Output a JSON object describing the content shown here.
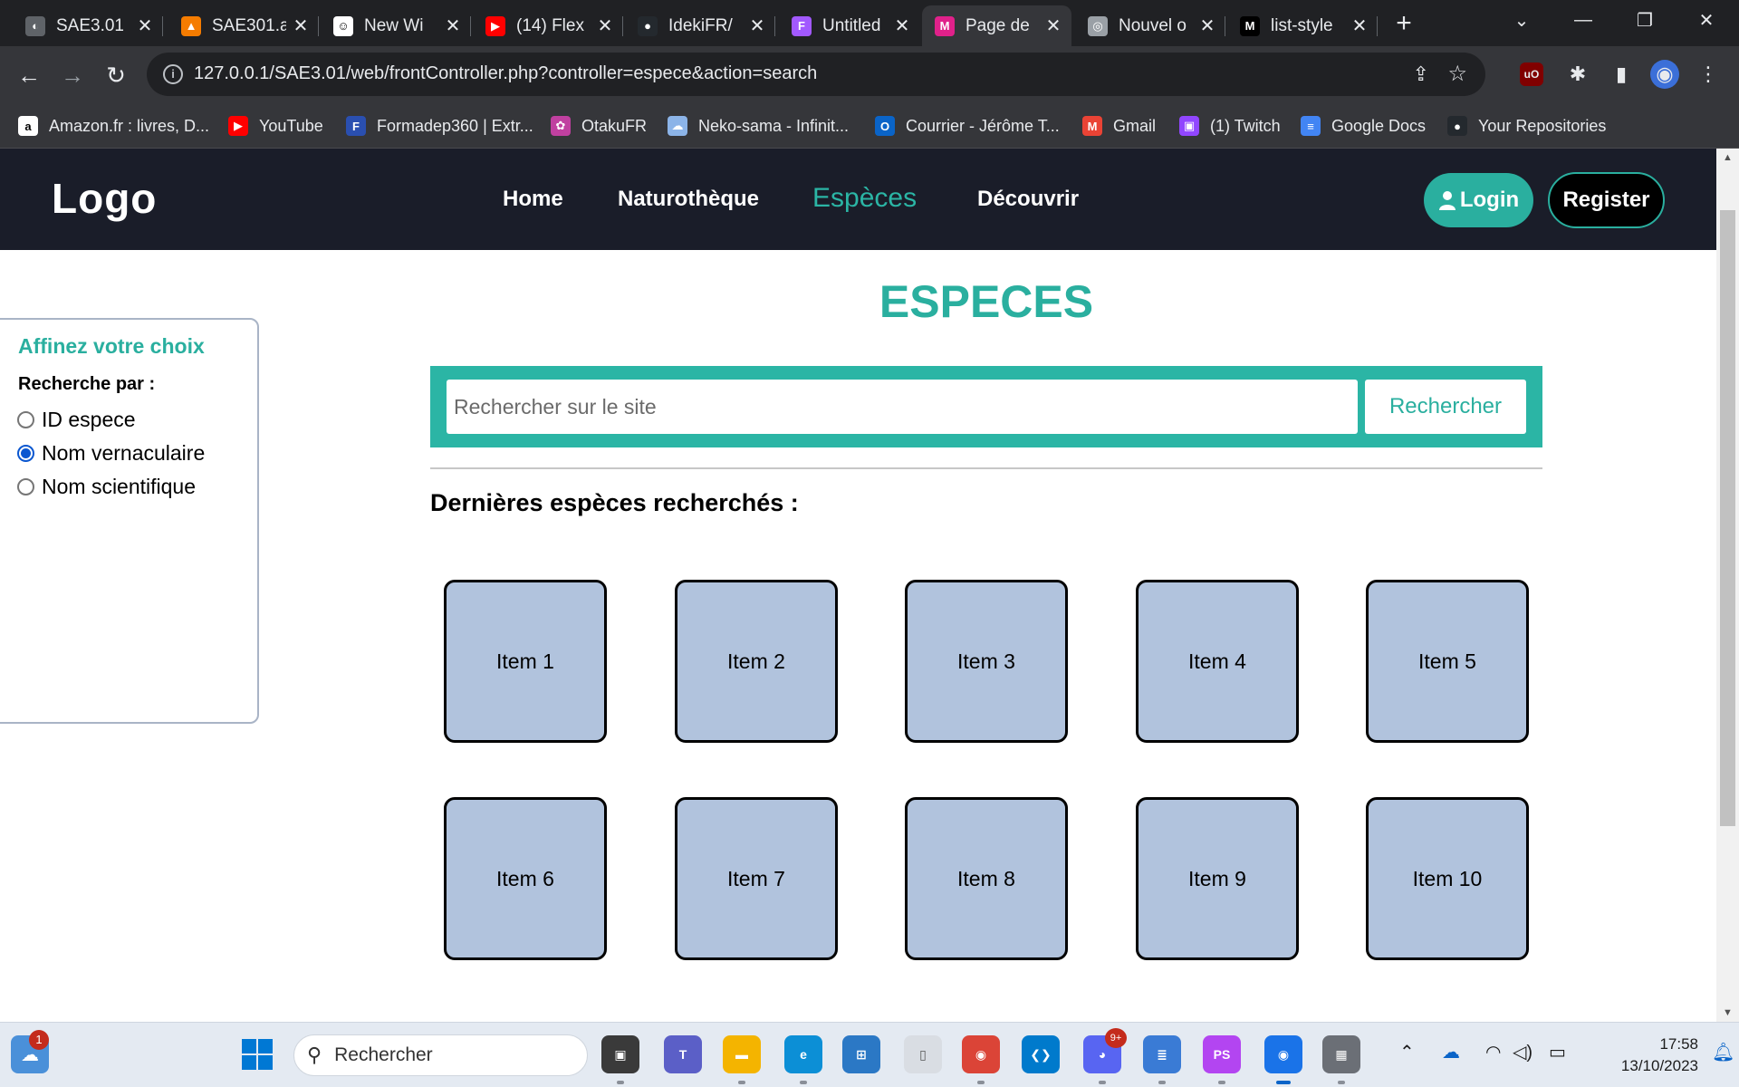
{
  "browser": {
    "tabs": [
      {
        "title": "SAE3.01",
        "color": "#5f6368",
        "glyph": "◐"
      },
      {
        "title": "SAE301.a",
        "color": "#f57c00",
        "glyph": "▲"
      },
      {
        "title": "New Wi",
        "color": "#ffffff",
        "glyph": "☺"
      },
      {
        "title": "(14) Flex",
        "color": "#ff0000",
        "glyph": "▶"
      },
      {
        "title": "IdekiFR/",
        "color": "#24292e",
        "glyph": "●"
      },
      {
        "title": "Untitled",
        "color": "#a259ff",
        "glyph": "F"
      },
      {
        "title": "Page de",
        "color": "#e0218a",
        "glyph": "M"
      },
      {
        "title": "Nouvel o",
        "color": "#9aa0a6",
        "glyph": "◎"
      },
      {
        "title": "list-style",
        "color": "#000000",
        "glyph": "M"
      }
    ],
    "active_tab_index": 6,
    "new_tab_label": "+",
    "window_controls": {
      "dropdown": "⌄",
      "minimize": "—",
      "restore": "❐",
      "close": "✕"
    },
    "nav": {
      "back": "←",
      "forward": "→",
      "reload": "↻"
    },
    "url": "127.0.0.1/SAE3.01/web/frontController.php?controller=espece&action=search",
    "info_icon_label": "i",
    "share_icon": "⇪",
    "star_icon": "☆",
    "extensions": [
      {
        "name": "ublock-icon",
        "glyph": "uO",
        "color": "#800000"
      },
      {
        "name": "puzzle-icon",
        "glyph": "✱",
        "color": "#35363a"
      },
      {
        "name": "sidepanel-icon",
        "glyph": "▮",
        "color": "#35363a"
      },
      {
        "name": "profile-avatar",
        "glyph": "◉",
        "color": "#3b6fd8"
      },
      {
        "name": "menu-icon",
        "glyph": "⋮",
        "color": "#35363a"
      }
    ],
    "bookmarks": [
      {
        "label": "Amazon.fr : livres, D...",
        "glyph": "a",
        "color": "#ffffff",
        "fg": "#000000"
      },
      {
        "label": "YouTube",
        "glyph": "▶",
        "color": "#ff0000",
        "fg": "#ffffff"
      },
      {
        "label": "Formadep360 | Extr...",
        "glyph": "F",
        "color": "#2a4fb0",
        "fg": "#ffffff"
      },
      {
        "label": "OtakuFR",
        "glyph": "✿",
        "color": "#c040a0",
        "fg": "#ffffff"
      },
      {
        "label": "Neko-sama - Infinit...",
        "glyph": "☁",
        "color": "#8cb4e8",
        "fg": "#ffffff"
      },
      {
        "label": "Courrier - Jérôme T...",
        "glyph": "O",
        "color": "#0a64c8",
        "fg": "#ffffff"
      },
      {
        "label": "Gmail",
        "glyph": "M",
        "color": "#ea4335",
        "fg": "#ffffff"
      },
      {
        "label": "(1) Twitch",
        "glyph": "▣",
        "color": "#9146ff",
        "fg": "#ffffff"
      },
      {
        "label": "Google Docs",
        "glyph": "≡",
        "color": "#4285f4",
        "fg": "#ffffff"
      },
      {
        "label": "Your Repositories",
        "glyph": "●",
        "color": "#24292e",
        "fg": "#ffffff"
      }
    ]
  },
  "site": {
    "logo": "Logo",
    "nav": [
      "Home",
      "Naturothèque",
      "Espèces",
      "Découvrir"
    ],
    "current_nav_index": 2,
    "login_label": "Login",
    "register_label": "Register",
    "accent_color": "#2aaf9f",
    "header_bg": "#1a1d29"
  },
  "filter": {
    "title": "Affinez votre choix",
    "search_by_label": "Recherche par :",
    "options": [
      {
        "label": "ID espece",
        "checked": false
      },
      {
        "label": "Nom vernaculaire",
        "checked": true
      },
      {
        "label": "Nom scientifique",
        "checked": false
      }
    ]
  },
  "main": {
    "title": "ESPECES",
    "search_placeholder": "Rechercher sur le site",
    "search_button": "Rechercher",
    "recent_title": "Dernières espèces recherchés :",
    "items": [
      "Item 1",
      "Item 2",
      "Item 3",
      "Item 4",
      "Item 5",
      "Item 6",
      "Item 7",
      "Item 8",
      "Item 9",
      "Item 10"
    ]
  },
  "taskbar": {
    "search_placeholder": "Rechercher",
    "weather_badge": "1",
    "discord_badge": "9+",
    "time": "17:58",
    "date": "13/10/2023",
    "apps": [
      {
        "name": "taskview-icon",
        "glyph": "▣",
        "color": "#3a3a3a"
      },
      {
        "name": "teams-icon",
        "glyph": "T",
        "color": "#5b5fc7"
      },
      {
        "name": "file-explorer-icon",
        "glyph": "▬",
        "color": "#f4b400"
      },
      {
        "name": "edge-icon",
        "glyph": "e",
        "color": "#0c8fd6"
      },
      {
        "name": "store-icon",
        "glyph": "⊞",
        "color": "#2b78c5"
      },
      {
        "name": "notepad-file-icon",
        "glyph": "▯",
        "color": "#d9dde3"
      },
      {
        "name": "chrome-icon",
        "glyph": "◉",
        "color": "#db4437"
      },
      {
        "name": "vscode-icon",
        "glyph": "❮❯",
        "color": "#007acc"
      },
      {
        "name": "discord-icon",
        "glyph": "◕",
        "color": "#5865f2"
      },
      {
        "name": "notepad-icon",
        "glyph": "≣",
        "color": "#3a7bd5"
      },
      {
        "name": "phpstorm-icon",
        "glyph": "PS",
        "color": "#b345f1"
      },
      {
        "name": "chrome-profile-icon",
        "glyph": "◉",
        "color": "#1a73e8"
      },
      {
        "name": "calculator-icon",
        "glyph": "▦",
        "color": "#6b6f76"
      }
    ]
  }
}
